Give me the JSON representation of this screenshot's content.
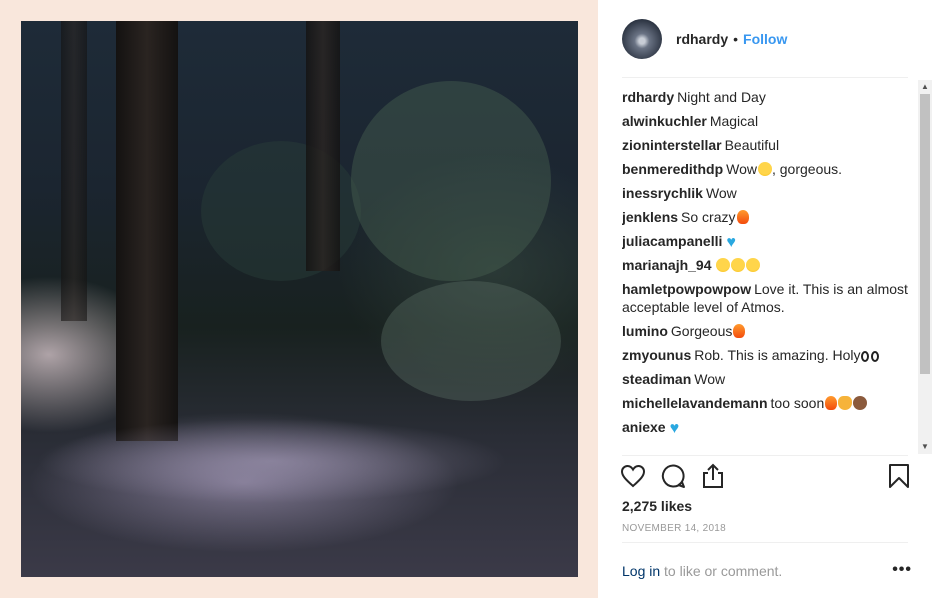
{
  "post": {
    "username": "rdhardy",
    "separator": "•",
    "follow_label": "Follow"
  },
  "comments": [
    {
      "user": "rdhardy",
      "text": "Night and Day",
      "emoji": []
    },
    {
      "user": "alwinkuchler",
      "text": "Magical",
      "emoji": []
    },
    {
      "user": "zioninterstellar",
      "text": "Beautiful",
      "emoji": []
    },
    {
      "user": "benmeredithdp",
      "text": "Wow",
      "emoji": [
        "heart-eyes"
      ],
      "tail": ", gorgeous."
    },
    {
      "user": "inessrychlik",
      "text": "Wow",
      "emoji": []
    },
    {
      "user": "jenklens",
      "text": "So crazy",
      "emoji": [
        "fire"
      ]
    },
    {
      "user": "juliacampanelli",
      "text": "",
      "emoji": [
        "blue-heart"
      ]
    },
    {
      "user": "marianajh_94",
      "text": "",
      "emoji": [
        "heart-eyes",
        "heart-eyes",
        "heart-eyes"
      ]
    },
    {
      "user": "hamletpowpowpow",
      "text": "Love it. This is an almost acceptable level of Atmos.",
      "emoji": []
    },
    {
      "user": "lumino",
      "text": "Gorgeous",
      "emoji": [
        "fire"
      ]
    },
    {
      "user": "zmyounus",
      "text": "Rob. This is amazing. Holy",
      "emoji": [
        "eyes",
        "eyes"
      ]
    },
    {
      "user": "steadiman",
      "text": "Wow",
      "emoji": []
    },
    {
      "user": "michellelavandemann",
      "text": "too soon",
      "emoji": [
        "fire",
        "cat",
        "monkey"
      ]
    },
    {
      "user": "aniexe",
      "text": "",
      "emoji": [
        "blue-heart"
      ]
    }
  ],
  "stats": {
    "likes": "2,275 likes",
    "date": "NOVEMBER 14, 2018"
  },
  "footer": {
    "login_link": "Log in",
    "login_rest": " to like or comment.",
    "more_label": "•••"
  },
  "scrollbar": {
    "up": "▲",
    "down": "▼"
  },
  "colors": {
    "accent": "#3897f0",
    "muted": "#999999",
    "link": "#003569",
    "panel_bg": "#f9e7dc"
  },
  "icons": [
    "heart-icon",
    "comment-icon",
    "share-icon",
    "bookmark-icon",
    "more-icon"
  ]
}
